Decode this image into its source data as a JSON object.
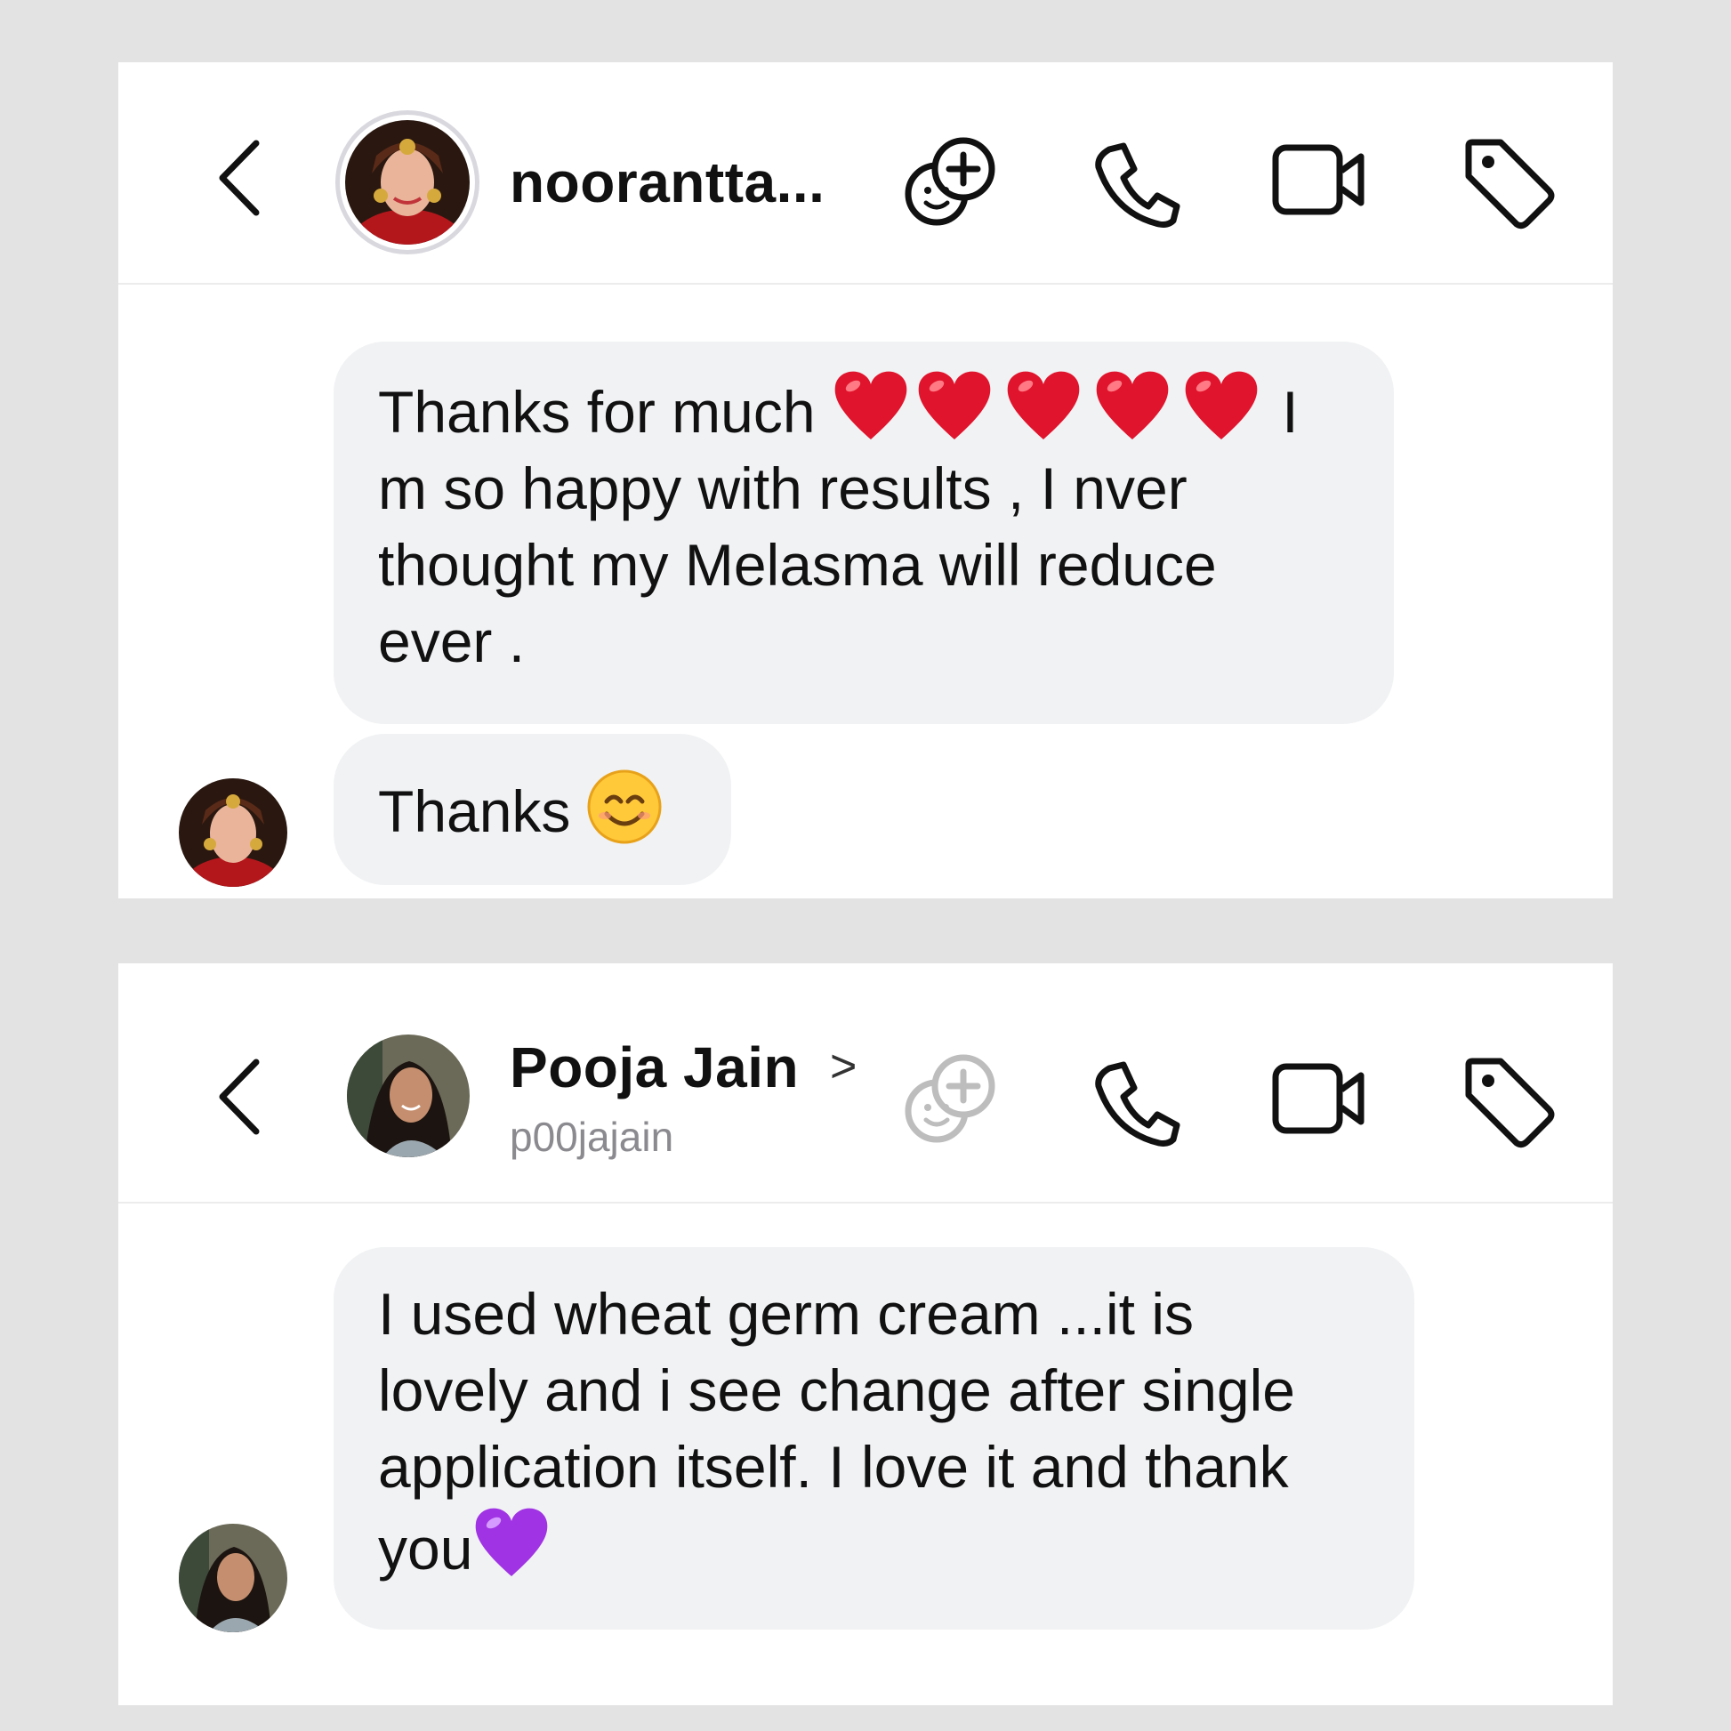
{
  "chat1": {
    "contact_name": "noorantta...",
    "messages": [
      {
        "text_main": "Thanks for much ",
        "hearts_after": 5,
        "text_rest": " I\nm so happy with results , I nver\nthought my Melasma will reduce\never ."
      },
      {
        "text": "Thanks "
      }
    ],
    "emoji": {
      "hearts": "red-heart",
      "smile": "smiling-face"
    }
  },
  "chat2": {
    "contact_name": "Pooja Jain",
    "chevron": ">",
    "username": "p00jajain",
    "messages": [
      {
        "text": "I used wheat germ cream ...it is\nlovely and i see change after single\napplication itself. I love it and thank\nyou"
      }
    ],
    "emoji": {
      "heart": "purple-heart"
    }
  },
  "colors": {
    "bubble": "#f1f2f4",
    "background": "#e3e3e4",
    "red_heart": "#e0142c",
    "purple_heart": "#a033e3",
    "disabled_icon": "#bdbdbd"
  }
}
